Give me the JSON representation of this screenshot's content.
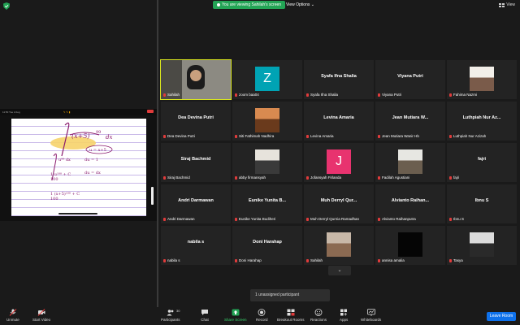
{
  "top": {
    "viewing_text": "You are viewing Sahilah's screen",
    "view_options": "View Options",
    "view_label": "View"
  },
  "share": {
    "toolbar_text": "11:50  Tue 2 Aug"
  },
  "participants": [
    {
      "name": "Sahilah",
      "type": "video"
    },
    {
      "name": "zoom baa04",
      "type": "letter",
      "letter": "Z",
      "color": "#00a3b4"
    },
    {
      "name": "Syafa Ifna Shalia",
      "type": "name"
    },
    {
      "name": "Viyana Putri",
      "type": "name"
    },
    {
      "name": "Fahima Nazmi",
      "type": "photo"
    },
    {
      "name": "Dea Devina Putri",
      "type": "name"
    },
    {
      "name": "Siti Fathimah Nadhira",
      "type": "photo"
    },
    {
      "name": "Levina Amaria",
      "type": "name"
    },
    {
      "name": "Jean Mutiara Wanir Hb",
      "display": "Jean Mutiara W...",
      "type": "name"
    },
    {
      "name": "Luthpiah Nur Azizah",
      "display": "Luthpiah Nur Az...",
      "type": "name"
    },
    {
      "name": "Siraj Bachmid",
      "type": "name"
    },
    {
      "name": "abby firmansyah",
      "type": "photo"
    },
    {
      "name": "Jofansyah Firlanda",
      "type": "letter",
      "letter": "J",
      "color": "#e8336f"
    },
    {
      "name": "Fadilah Agustiani",
      "type": "photo"
    },
    {
      "name": "fajri",
      "type": "name"
    },
    {
      "name": "Andri Darmawan",
      "type": "name"
    },
    {
      "name": "Eunike Yunita Budiheri",
      "display": "Eunike Yunita B...",
      "type": "name"
    },
    {
      "name": "Muh Derryl Qurnia Ramadhan",
      "display": "Muh Derryl Qur...",
      "type": "name"
    },
    {
      "name": "Alvianto Raihanputra",
      "display": "Alvianto Raihan...",
      "type": "name"
    },
    {
      "name": "Ibnu S",
      "type": "name"
    },
    {
      "name": "nabila s",
      "type": "name"
    },
    {
      "name": "Doni Harahap",
      "type": "name"
    },
    {
      "name": "Sahilah",
      "type": "photo"
    },
    {
      "name": "annisa amalia",
      "type": "photo"
    },
    {
      "name": "Tasya",
      "type": "photo"
    }
  ],
  "unassigned": "1 unassigned participant",
  "toolbar": {
    "unmute": "Unmute",
    "start_video": "Start Video",
    "participants": "Participants",
    "participants_count": "30",
    "chat": "Chat",
    "share_screen": "Share Screen",
    "record": "Record",
    "breakout_rooms": "Breakout Rooms",
    "reactions": "Reactions",
    "apps": "Apps",
    "whiteboards": "Whiteboards",
    "leave": "Leave Room"
  },
  "colors": {
    "accent_green": "#23a455",
    "leave_blue": "#0e71eb",
    "active_speaker": "#d9e61e",
    "muted_red": "#e03b3b"
  }
}
